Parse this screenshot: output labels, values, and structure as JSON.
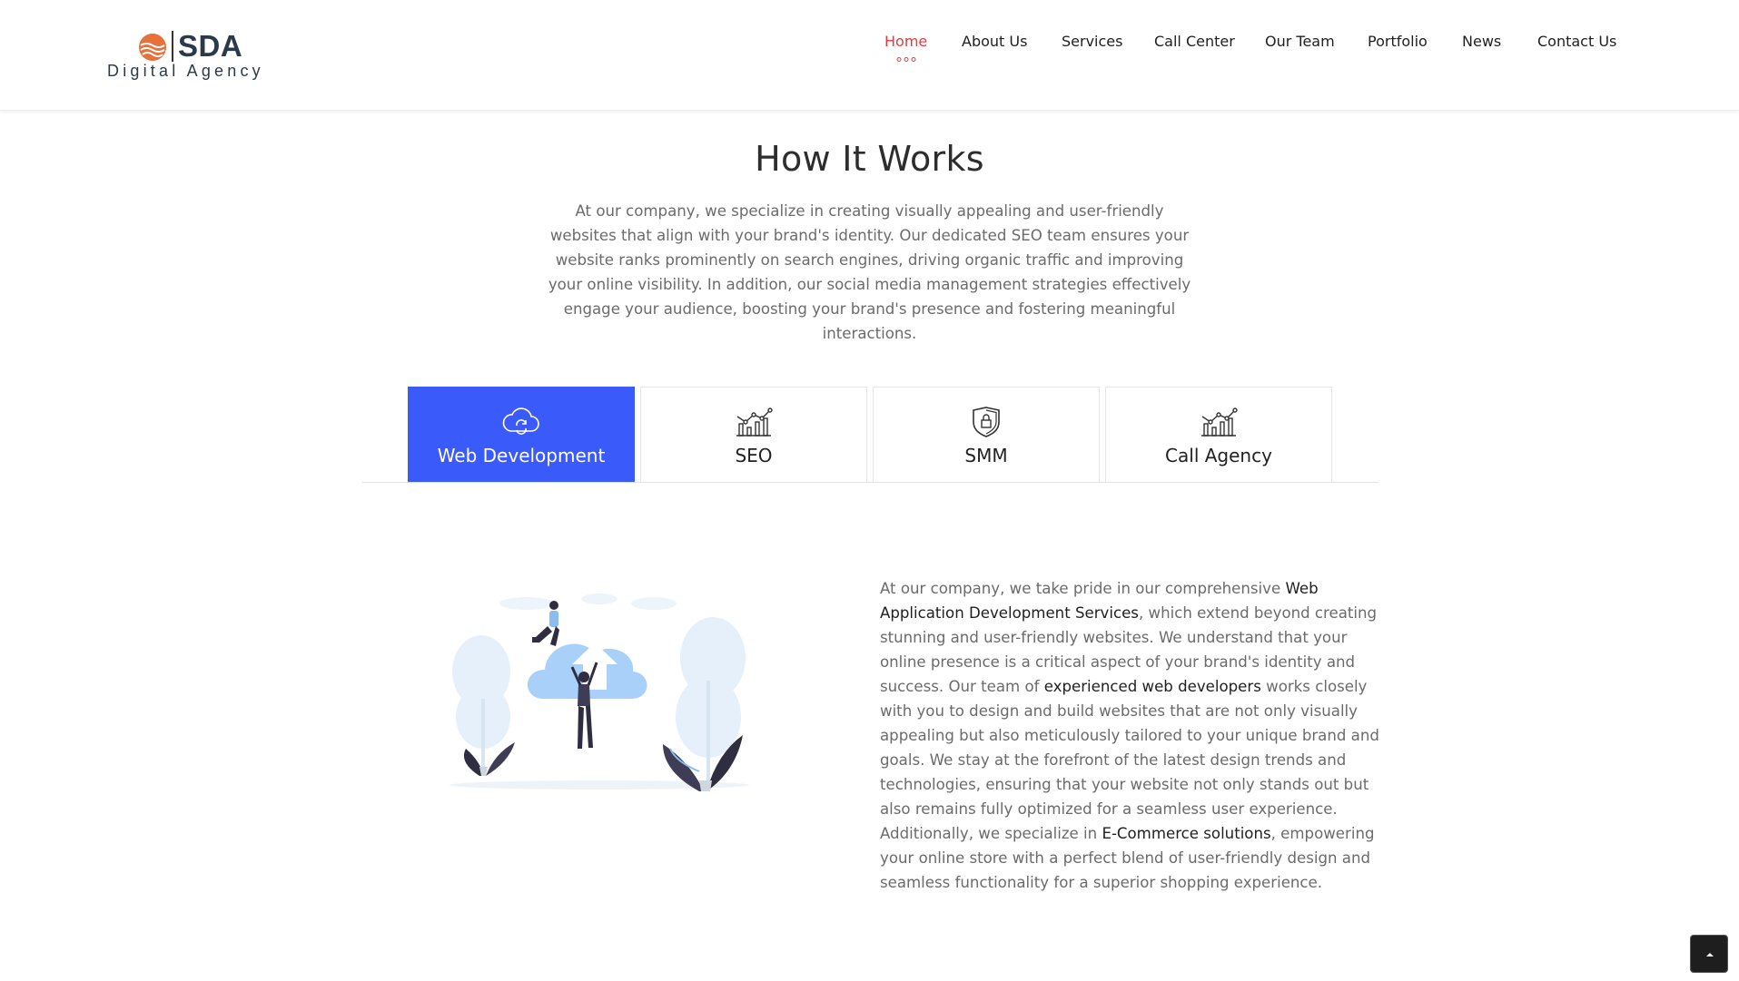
{
  "brand": {
    "name": "SDA",
    "tagline": "Digital Agency",
    "accent": "#e8393c",
    "logo_color": "#e8703a"
  },
  "nav": {
    "items": [
      {
        "label": "Home",
        "active": true
      },
      {
        "label": "About Us"
      },
      {
        "label": "Services"
      },
      {
        "label": "Call Center"
      },
      {
        "label": "Our Team"
      },
      {
        "label": "Portfolio"
      },
      {
        "label": "News"
      },
      {
        "label": "Contact Us"
      }
    ]
  },
  "section": {
    "title": "How It Works",
    "intro": "At our company, we specialize in creating visually appealing and user-friendly websites that align with your brand's identity. Our dedicated SEO team ensures your website ranks prominently on search engines, driving organic traffic and improving your online visibility. In addition, our social media management strategies effectively engage your audience, boosting your brand's presence and fostering meaningful interactions."
  },
  "tabs": [
    {
      "label": "Web Development",
      "icon": "cloud-sync-icon",
      "active": true
    },
    {
      "label": "SEO",
      "icon": "chart-growth-icon"
    },
    {
      "label": "SMM",
      "icon": "shield-lock-icon"
    },
    {
      "label": "Call Agency",
      "icon": "chart-growth-icon"
    }
  ],
  "content": {
    "p1": "At our company, we take pride in our comprehensive ",
    "h1": "Web Application Development Services",
    "p2": ", which extend beyond creating stunning and user-friendly websites. We understand that your online presence is a critical aspect of your brand's identity and success. Our team of ",
    "h2": "experienced web developers",
    "p3": " works closely with you to design and build websites that are not only visually appealing but also meticulously tailored to your unique brand and goals. We stay at the forefront of the latest design trends and technologies, ensuring that your website not only stands out but also remains fully optimized for a seamless user experience. Additionally, we specialize in ",
    "h3": "E-Commerce solutions",
    "p4": ", empowering your online store with a perfect blend of user-friendly design and seamless functionality for a superior shopping experience."
  },
  "colors": {
    "active_tab": "#3a5af9"
  }
}
